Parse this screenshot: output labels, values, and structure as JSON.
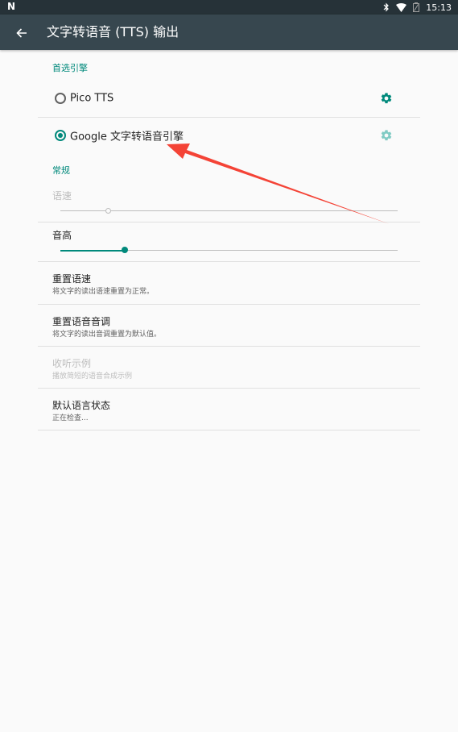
{
  "status_bar": {
    "left_icon": "N",
    "time": "15:13",
    "icons": [
      "bluetooth-icon",
      "wifi-icon",
      "battery-icon"
    ]
  },
  "app_bar": {
    "title": "文字转语音 (TTS) 输出",
    "back_icon": "arrow-left-icon"
  },
  "engines": {
    "header": "首选引擎",
    "items": [
      {
        "label": "Pico TTS",
        "selected": false,
        "settings_enabled": true
      },
      {
        "label": "Google 文字转语音引擎",
        "selected": true,
        "settings_enabled": false
      }
    ]
  },
  "general": {
    "header": "常规",
    "speech_rate": {
      "label": "语速",
      "enabled": false,
      "level": 0.14
    },
    "pitch": {
      "label": "音高",
      "enabled": true,
      "level": 0.19
    },
    "reset_rate": {
      "title": "重置语速",
      "summary": "将文字的读出语速重置为正常。"
    },
    "reset_pitch": {
      "title": "重置语音音调",
      "summary": "将文字的读出音调重置为默认值。"
    },
    "listen_example": {
      "title": "收听示例",
      "summary": "播放简短的语音合成示例",
      "enabled": false
    },
    "default_language": {
      "title": "默认语言状态",
      "summary": "正在检查..."
    }
  },
  "colors": {
    "accent": "#00897b",
    "app_bar": "#37474f",
    "status_bar": "#263238",
    "annotation_arrow": "#f44336"
  }
}
